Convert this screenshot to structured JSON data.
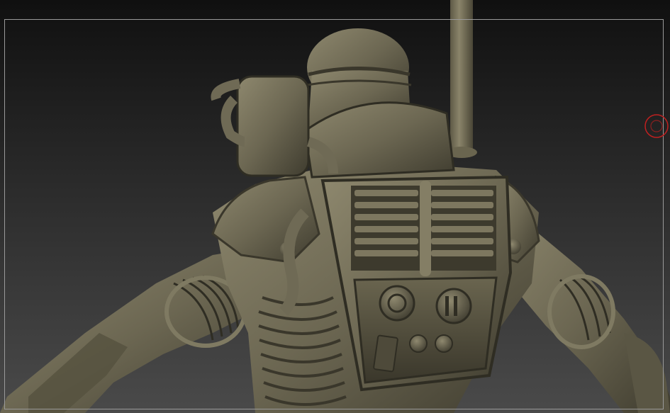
{
  "viewport": {
    "canvas": "3d-sculpt-viewport",
    "model": "astronaut-figure-sculpt"
  },
  "colors": {
    "background_top": "#101010",
    "background_bottom": "#4a4a4a",
    "frame": "#9a9a9a",
    "clay": "#6f6a55",
    "clay_shadow": "#3e3b2e",
    "clay_highlight": "#908a70",
    "gizmo": "#c02020"
  },
  "icons": {
    "navigation_gizmo": "target-circle-icon"
  }
}
